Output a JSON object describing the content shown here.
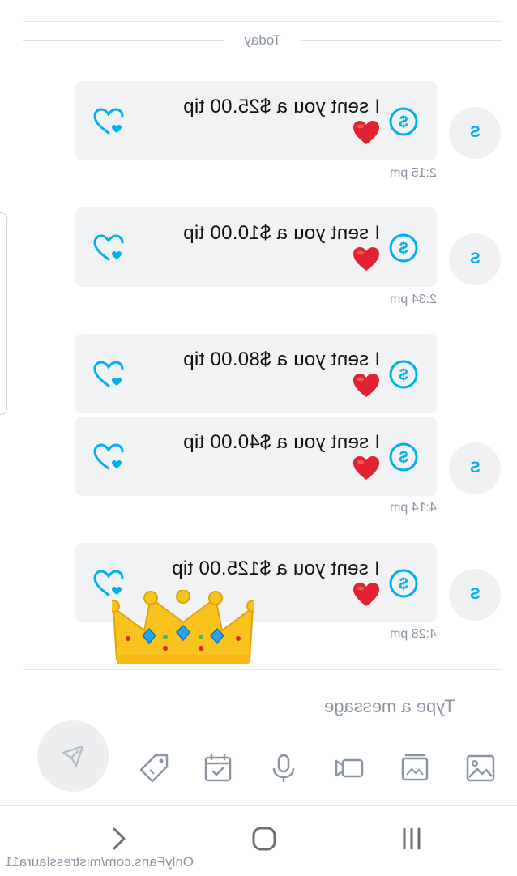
{
  "chat": {
    "date_divider": "Today",
    "avatar_initial": "S",
    "messages": [
      {
        "text": "I sent you a $25.00 tip",
        "time": "2:15 pm"
      },
      {
        "text": "I sent you a $10.00 tip",
        "time": "2:34 pm"
      },
      {
        "text": "I sent you a $80.00 tip",
        "time": ""
      },
      {
        "text": "I sent you a $40.00 tip",
        "time": "4:14 pm"
      },
      {
        "text": "I sent you a $125.00 tip",
        "time": "4:28 pm"
      }
    ]
  },
  "composer": {
    "placeholder": "Type a message",
    "tools": [
      "image-icon",
      "vault-icon",
      "video-icon",
      "microphone-icon",
      "calendar-icon",
      "price-tag-icon"
    ],
    "send_icon": "send-icon"
  },
  "system_nav": {
    "items": [
      "back-button",
      "home-button",
      "recents-button"
    ]
  },
  "watermark": "OnlyFans.com/mistresslaura11",
  "colors": {
    "accent": "#00aff0",
    "bubble": "#f1f2f4",
    "muted_text": "#8a96a3",
    "heart": "#e0232e"
  }
}
